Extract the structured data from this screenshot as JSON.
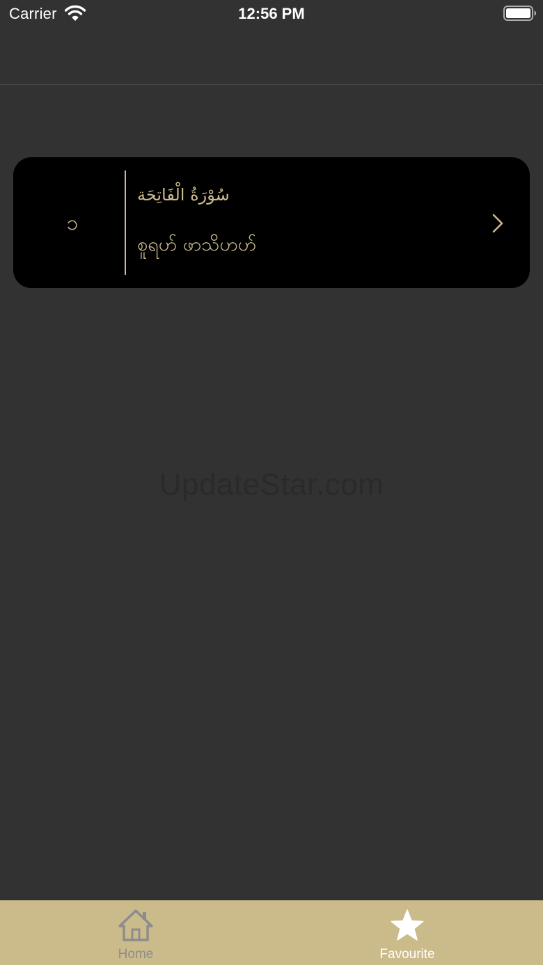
{
  "status_bar": {
    "carrier": "Carrier",
    "time": "12:56 PM",
    "wifi_icon": "wifi-icon",
    "battery_icon": "battery-icon"
  },
  "favourites": [
    {
      "number": "၁",
      "arabic_name": "سُوْرَةُ الْفَاتِحَة",
      "transliteration": "စူရဟ် ဖာသိဟဟ်"
    }
  ],
  "watermark": "UpdateStar.com",
  "tabs": [
    {
      "label": "Home",
      "icon": "home-icon",
      "selected": false
    },
    {
      "label": "Favourite",
      "icon": "star-icon",
      "selected": true
    }
  ],
  "colors": {
    "background": "#323232",
    "card": "#000000",
    "gold": "#cbbb8b",
    "tab_active": "#ffffff",
    "tab_inactive": "#8c8c8c"
  }
}
